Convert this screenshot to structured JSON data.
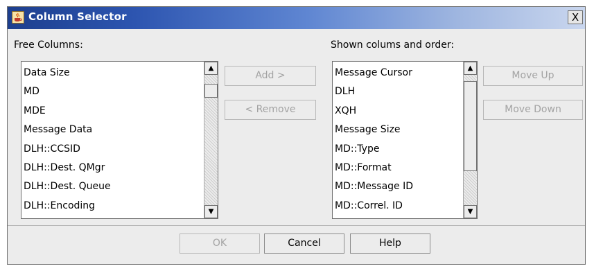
{
  "window": {
    "title": "Column Selector",
    "close_label": "X"
  },
  "free_columns": {
    "label": "Free Columns:",
    "items": [
      "Data Size",
      "MD",
      "MDE",
      "Message Data",
      "DLH::CCSID",
      "DLH::Dest. QMgr",
      "DLH::Dest. Queue",
      "DLH::Encoding"
    ]
  },
  "shown_columns": {
    "label": "Shown colums and order:",
    "items": [
      "Message Cursor",
      "DLH",
      "XQH",
      "Message Size",
      "MD::Type",
      "MD::Format",
      "MD::Message ID",
      "MD::Correl. ID"
    ]
  },
  "buttons": {
    "add": "Add >",
    "remove": "< Remove",
    "move_up": "Move Up",
    "move_down": "Move Down",
    "ok": "OK",
    "cancel": "Cancel",
    "help": "Help"
  },
  "icons": {
    "scroll_up": "▲",
    "scroll_down": "▼"
  },
  "colors": {
    "titlebar_start": "#1d3f8e",
    "titlebar_end": "#c9d6ee",
    "disabled_text": "#a3a3a3"
  }
}
